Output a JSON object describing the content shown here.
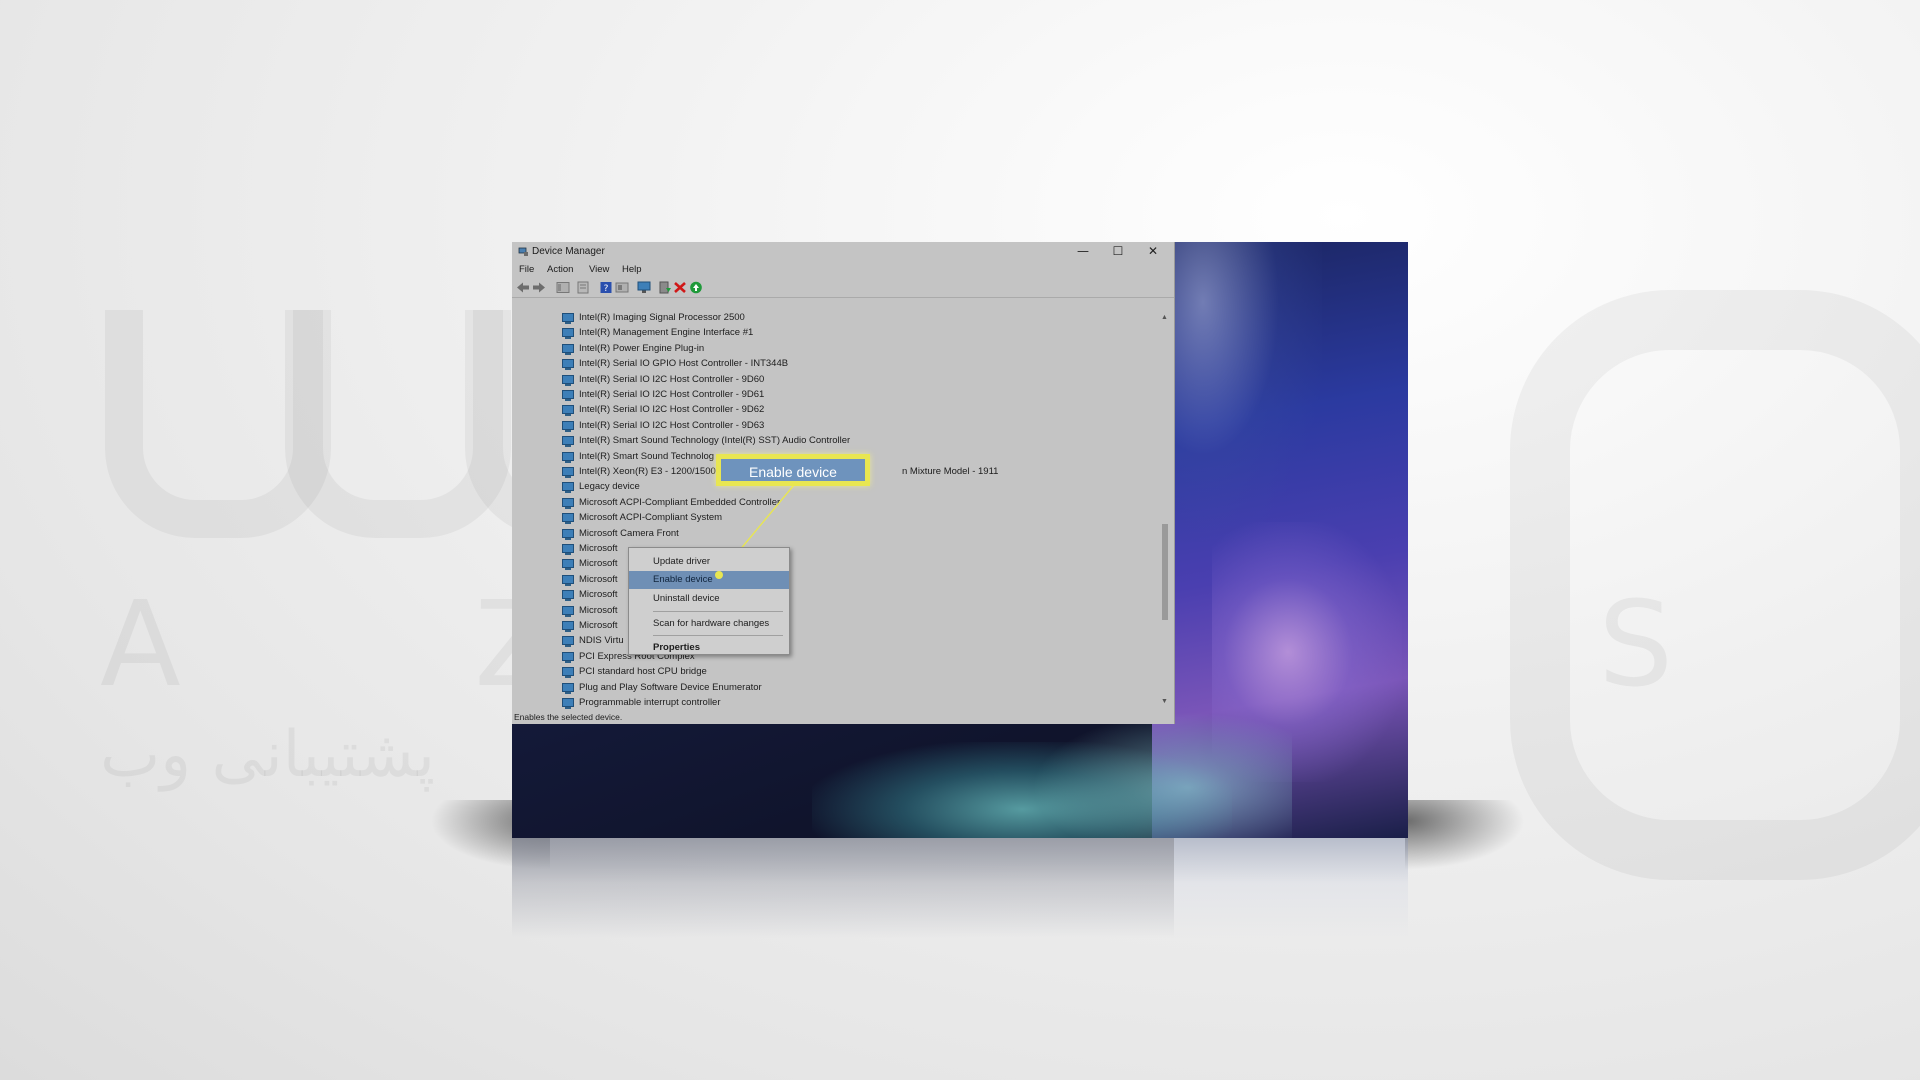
{
  "window": {
    "title": "Device Manager",
    "controls": {
      "minimize": "—",
      "maximize": "☐",
      "close": "✕"
    }
  },
  "menu": {
    "file": "File",
    "action": "Action",
    "view": "View",
    "help": "Help"
  },
  "toolbar": {
    "icons": [
      "back-arrow-icon",
      "forward-arrow-icon",
      "console-tree-icon",
      "properties-icon",
      "help-icon",
      "show-hide-icon",
      "monitor-icon",
      "update-driver-icon",
      "uninstall-icon",
      "enable-device-icon"
    ],
    "colors": {
      "uninstall": "#d01818",
      "enable": "#1f9a3a",
      "help": "#2a4fae"
    }
  },
  "devices": [
    "Intel(R) Imaging Signal Processor 2500",
    "Intel(R) Management Engine Interface #1",
    "Intel(R) Power Engine Plug-in",
    "Intel(R) Serial IO GPIO Host Controller - INT344B",
    "Intel(R) Serial IO I2C Host Controller - 9D60",
    "Intel(R) Serial IO I2C Host Controller - 9D61",
    "Intel(R) Serial IO I2C Host Controller - 9D62",
    "Intel(R) Serial IO I2C Host Controller - 9D63",
    "Intel(R) Smart Sound Technology (Intel(R) SST) Audio Controller",
    "Intel(R) Smart Sound Technolog",
    "Intel(R) Xeon(R) E3 - 1200/1500",
    "Legacy device",
    "Microsoft ACPI-Compliant Embedded Controller",
    "Microsoft ACPI-Compliant System",
    "Microsoft Camera Front",
    "Microsoft",
    "Microsoft",
    "Microsoft",
    "Microsoft",
    "Microsoft",
    "Microsoft",
    "NDIS Virtu",
    "PCI Express Root Complex",
    "PCI standard host CPU bridge",
    "Plug and Play Software Device Enumerator",
    "Programmable interrupt controller"
  ],
  "xeon_suffix": "n Mixture Model - 1911",
  "context_menu": {
    "update_driver": "Update driver",
    "enable_device": "Enable device",
    "uninstall_device": "Uninstall device",
    "scan": "Scan for hardware changes",
    "properties": "Properties"
  },
  "callout": {
    "label": "Enable device",
    "border_color": "#e8e651",
    "fill_color": "#6e93bd"
  },
  "status_text": "Enables the selected device.",
  "watermark": {
    "letters": "A Z A R S",
    "subtitle": "پشتیبانی وب"
  }
}
